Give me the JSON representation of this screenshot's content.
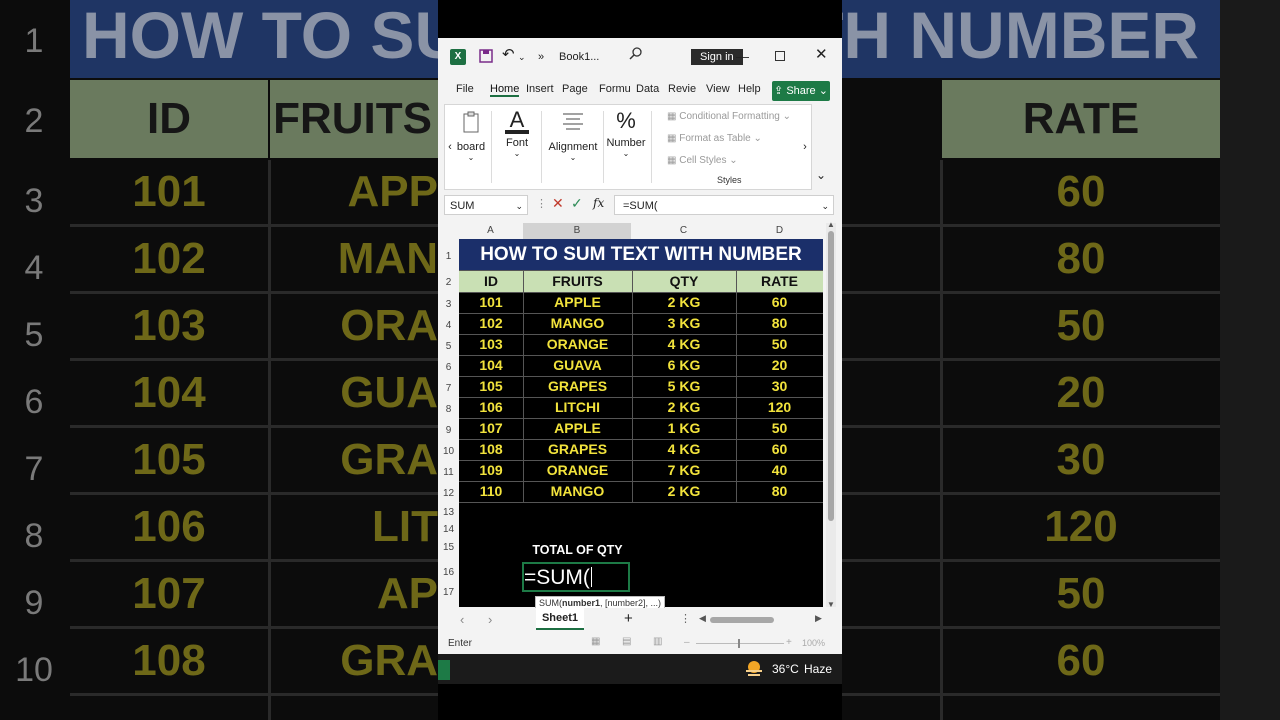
{
  "background": {
    "title": "HOW TO SUM TEXT WITH NUMBER",
    "row_numbers": [
      "1",
      "2",
      "3",
      "4",
      "5",
      "6",
      "7",
      "8",
      "9",
      "10"
    ],
    "col_id_header": "ID",
    "col_fruits_header": "FRUITS",
    "col_rate_header": "RATE",
    "ids": [
      "101",
      "102",
      "103",
      "104",
      "105",
      "106",
      "107",
      "108"
    ],
    "fruits_partial": [
      "APP",
      "MAN",
      "ORA",
      "GUA",
      "GRA",
      "LIT",
      "AP",
      "GRA"
    ],
    "rates": [
      "60",
      "80",
      "50",
      "20",
      "30",
      "120",
      "50",
      "60"
    ]
  },
  "titlebar": {
    "file_name": "Book1...",
    "sign_in": "Sign in",
    "undo": "↶",
    "more": "»"
  },
  "menu": {
    "items": [
      "File",
      "Home",
      "Insert",
      "Page",
      "Formu",
      "Data",
      "Revie",
      "View",
      "Help"
    ],
    "share": "Share"
  },
  "ribbon": {
    "clipboard": "board",
    "font": "Font",
    "alignment": "Alignment",
    "number": "Number",
    "conditional_formatting": "Conditional Formatting",
    "format_as_table": "Format as Table",
    "cell_styles": "Cell Styles",
    "styles_group": "Styles"
  },
  "formula_bar": {
    "name_box": "SUM",
    "formula": "=SUM("
  },
  "columns": [
    "A",
    "B",
    "C",
    "D"
  ],
  "rows": [
    "1",
    "2",
    "3",
    "4",
    "5",
    "6",
    "7",
    "8",
    "9",
    "10",
    "11",
    "12",
    "13",
    "14",
    "15",
    "16",
    "17"
  ],
  "sheet": {
    "title": "HOW TO SUM TEXT WITH NUMBER",
    "headers": [
      "ID",
      "FRUITS",
      "QTY",
      "RATE"
    ],
    "data": [
      [
        "101",
        "APPLE",
        "2 KG",
        "60"
      ],
      [
        "102",
        "MANGO",
        "3 KG",
        "80"
      ],
      [
        "103",
        "ORANGE",
        "4 KG",
        "50"
      ],
      [
        "104",
        "GUAVA",
        "6 KG",
        "20"
      ],
      [
        "105",
        "GRAPES",
        "5 KG",
        "30"
      ],
      [
        "106",
        "LITCHI",
        "2 KG",
        "120"
      ],
      [
        "107",
        "APPLE",
        "1 KG",
        "50"
      ],
      [
        "108",
        "GRAPES",
        "4 KG",
        "60"
      ],
      [
        "109",
        "ORANGE",
        "7 KG",
        "40"
      ],
      [
        "110",
        "MANGO",
        "2 KG",
        "80"
      ]
    ],
    "total_label": "TOTAL OF QTY",
    "active_cell": "=SUM(",
    "tooltip_prefix": "SUM(",
    "tooltip_bold": "number1",
    "tooltip_rest": ", [number2], ...)"
  },
  "sheet_tabs": {
    "active": "Sheet1",
    "add": "+"
  },
  "status": {
    "mode": "Enter",
    "zoom": "100%"
  },
  "taskbar": {
    "temperature": "36°C",
    "weather": "Haze"
  },
  "colors": {
    "title_bg": "#1b2f6a",
    "header_bg": "#c9e0b4",
    "data_text": "#f2e33c",
    "excel_green": "#1d6f42"
  }
}
